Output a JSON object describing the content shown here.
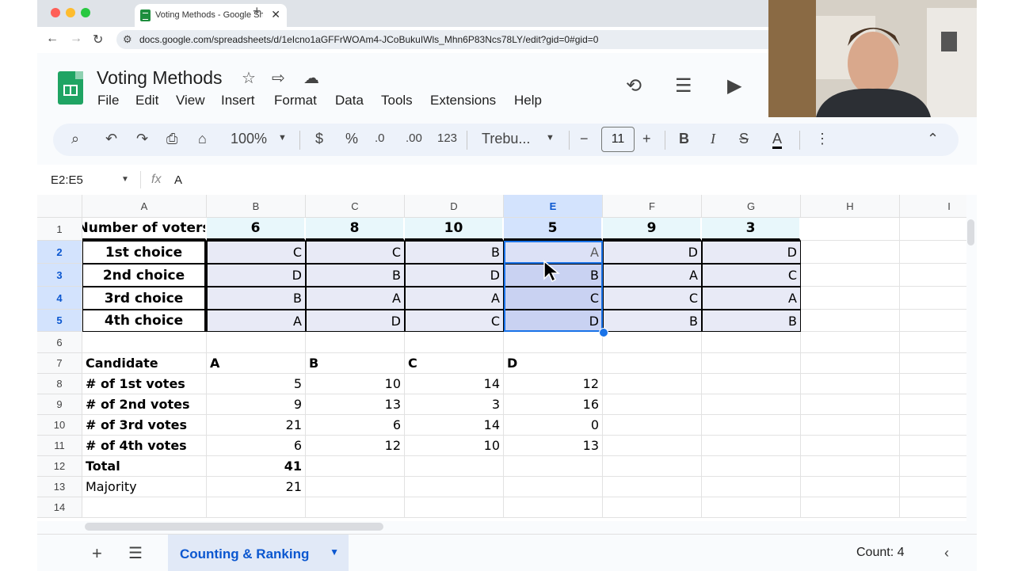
{
  "browser": {
    "tab_title": "Voting Methods - Google She",
    "url": "docs.google.com/spreadsheets/d/1eIcno1aGFFrWOAm4-JCoBukuIWls_Mhn6P83Ncs78LY/edit?gid=0#gid=0"
  },
  "sheets": {
    "title": "Voting Methods",
    "menu": [
      "File",
      "Edit",
      "View",
      "Insert",
      "Format",
      "Data",
      "Tools",
      "Extensions",
      "Help"
    ],
    "toolbar": {
      "zoom": "100%",
      "currency": "$",
      "percent": "%",
      "dec_decrease": ".0",
      "dec_increase": ".00",
      "number_format": "123",
      "font": "Trebu...",
      "font_size": "11",
      "bold": "B",
      "italic": "I",
      "text_color": "A"
    },
    "name_box": "E2:E5",
    "formula_value": "A",
    "columns": [
      "A",
      "B",
      "C",
      "D",
      "E",
      "F",
      "G",
      "H",
      "I"
    ],
    "rows": [
      "1",
      "2",
      "3",
      "4",
      "5",
      "6",
      "7",
      "8",
      "9",
      "10",
      "11",
      "12",
      "13",
      "14"
    ],
    "cells": {
      "row1": [
        "Number of voters",
        "6",
        "8",
        "10",
        "5",
        "9",
        "3"
      ],
      "row2": [
        "1st choice",
        "C",
        "C",
        "B",
        "A",
        "D",
        "D"
      ],
      "row3": [
        "2nd choice",
        "D",
        "B",
        "D",
        "B",
        "A",
        "C"
      ],
      "row4": [
        "3rd choice",
        "B",
        "A",
        "A",
        "C",
        "C",
        "A"
      ],
      "row5": [
        "4th choice",
        "A",
        "D",
        "C",
        "D",
        "B",
        "B"
      ],
      "row7": [
        "Candidate",
        "A",
        "B",
        "C",
        "D"
      ],
      "row8": [
        "# of 1st votes",
        "5",
        "10",
        "14",
        "12"
      ],
      "row9": [
        "# of 2nd votes",
        "9",
        "13",
        "3",
        "16"
      ],
      "row10": [
        "# of 3rd votes",
        "21",
        "6",
        "14",
        "0"
      ],
      "row11": [
        "# of 4th votes",
        "6",
        "12",
        "10",
        "13"
      ],
      "row12": [
        "Total",
        "41"
      ],
      "row13": [
        "Majority",
        "21"
      ]
    },
    "sheet_tab": "Counting & Ranking",
    "status": "Count: 4"
  },
  "colors": {
    "accent": "#0b57d0",
    "selection": "#e8eaf6",
    "header_row": "#e8f7fb"
  }
}
